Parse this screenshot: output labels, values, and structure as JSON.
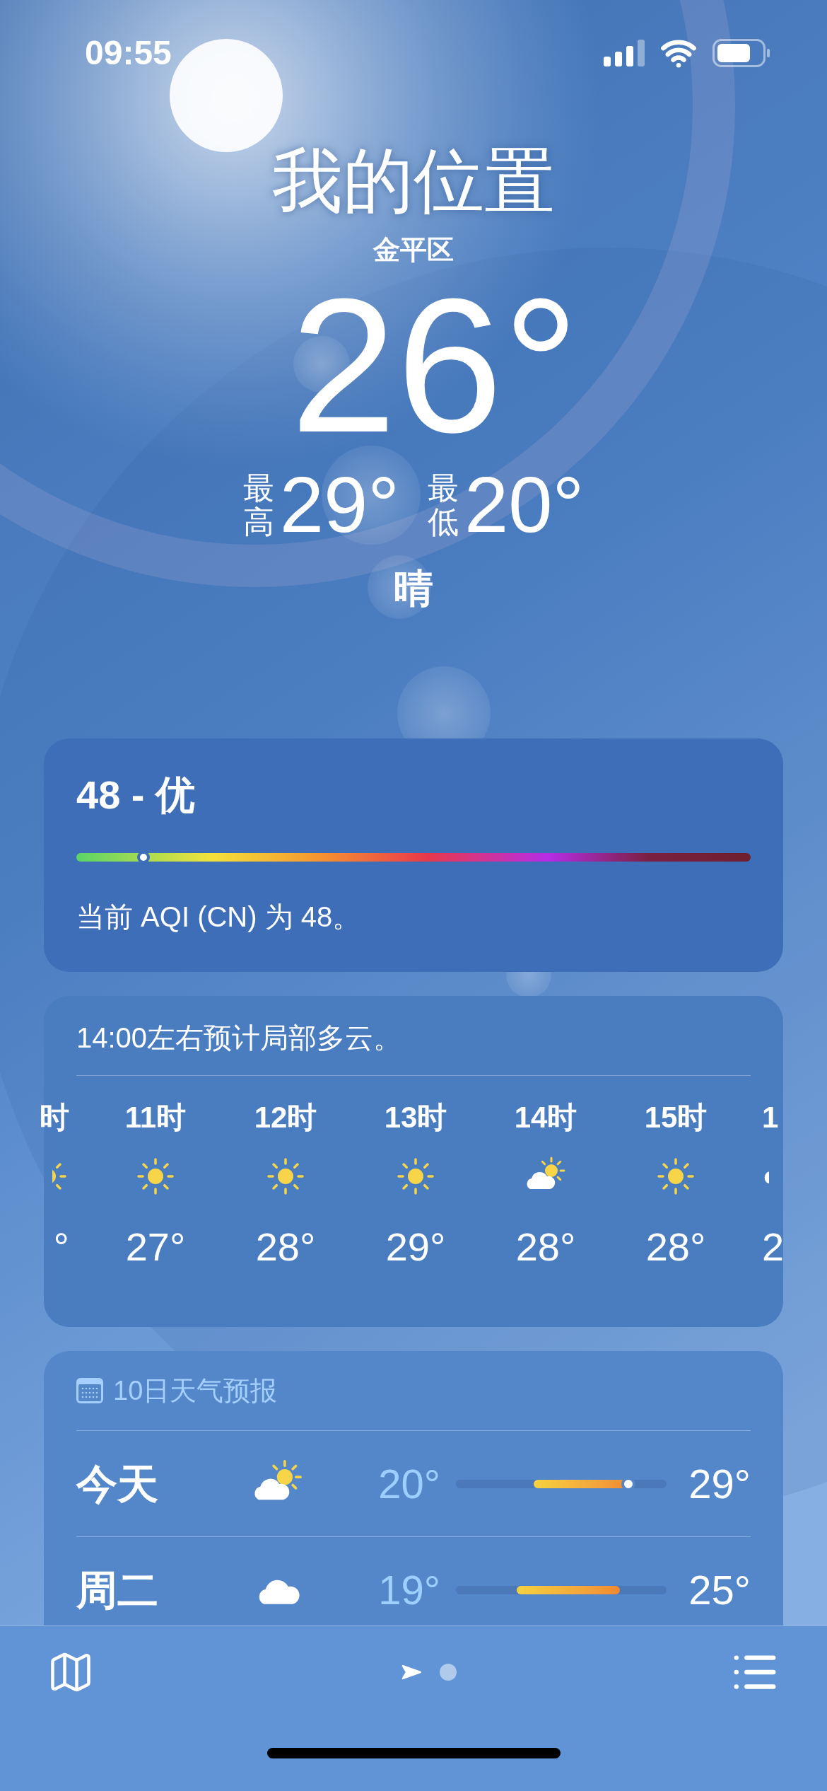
{
  "status_bar": {
    "time": "09:55"
  },
  "location": {
    "title": "我的位置",
    "subtitle": "金平区"
  },
  "current": {
    "temperature": "26°",
    "high_label": "最高",
    "high": "29°",
    "low_label": "最低",
    "low": "20°",
    "condition": "晴"
  },
  "air_quality": {
    "heading": "48 - 优",
    "level": 0.1,
    "description": "当前 AQI (CN) 为 48。"
  },
  "hourly": {
    "summary": "14:00左右预计局部多云。",
    "hours": [
      {
        "kind": "sun",
        "hour": "时",
        "temp": "°"
      },
      {
        "kind": "sun",
        "hour": "11时",
        "temp": "27°"
      },
      {
        "kind": "sun",
        "hour": "12时",
        "temp": "28°"
      },
      {
        "kind": "sun",
        "hour": "13时",
        "temp": "29°"
      },
      {
        "kind": "partly-cloudy",
        "hour": "14时",
        "temp": "28°"
      },
      {
        "kind": "sun",
        "hour": "15时",
        "temp": "28°"
      },
      {
        "kind": "cloud",
        "hour": "1",
        "temp": "2"
      }
    ]
  },
  "ten_day": {
    "title": "10日天气预报",
    "days": [
      {
        "day": "今天",
        "kind": "partly-cloudy",
        "low": "20°",
        "high": "29°",
        "current": {
          "level": 0.82
        }
      },
      {
        "day": "周二",
        "kind": "cloud",
        "low": "19°",
        "high": "25°"
      }
    ]
  },
  "bottom_bar": {
    "pages": [
      {
        "kind": "location",
        "selected": true
      },
      {
        "kind": "dot",
        "selected": false
      }
    ]
  }
}
